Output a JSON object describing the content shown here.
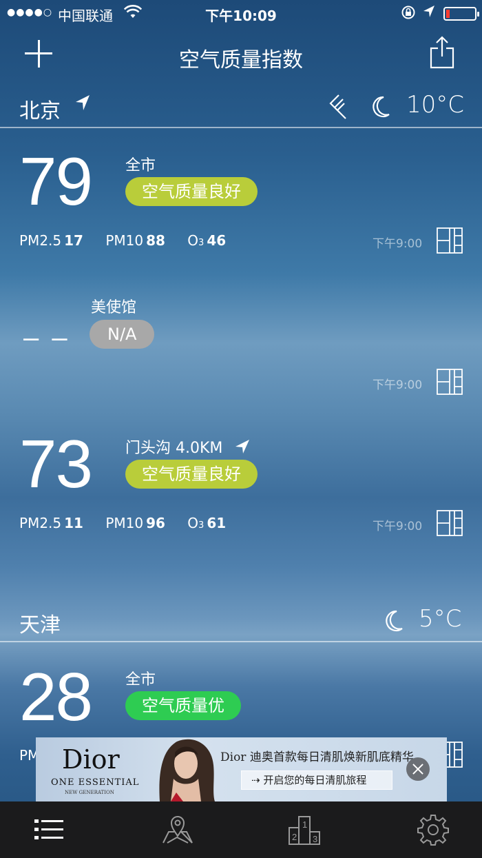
{
  "status_bar": {
    "signal_dots": "●●●●○",
    "carrier": "中国联通",
    "time": "下午10:09",
    "battery_level": 0.12,
    "battery_color": "#ff3b30"
  },
  "nav": {
    "title": "空气质量指数",
    "left_icon": "plus-icon",
    "right_icon": "share-icon"
  },
  "cities": [
    {
      "name": "北京",
      "temperature": "10°C",
      "weather_icon": "moon-icon",
      "extra_icon": "wind-icon",
      "stations": [
        {
          "aqi": "79",
          "name": "全市",
          "status": "空气质量良好",
          "status_color": "#b9cd3a",
          "metrics": [
            {
              "label": "PM2.5",
              "value": "17"
            },
            {
              "label": "PM10",
              "value": "88"
            },
            {
              "label": "O",
              "sub": "3",
              "value": "46"
            }
          ],
          "updated": "下午9:00"
        },
        {
          "aqi": "– –",
          "name": "美使馆",
          "status": "N/A",
          "status_color": "#a8a8a8",
          "updated": "下午9:00"
        },
        {
          "aqi": "73",
          "name": "门头沟 4.0KM",
          "status": "空气质量良好",
          "status_color": "#b9cd3a",
          "metrics": [
            {
              "label": "PM2.5",
              "value": "11"
            },
            {
              "label": "PM10",
              "value": "96"
            },
            {
              "label": "O",
              "sub": "3",
              "value": "61"
            }
          ],
          "updated": "下午9:00"
        }
      ]
    },
    {
      "name": "天津",
      "temperature": "5°C",
      "weather_icon": "moon-icon",
      "stations": [
        {
          "aqi": "28",
          "name": "全市",
          "status": "空气质量优",
          "status_color": "#2ecc52",
          "metrics_peek": "PM"
        }
      ]
    }
  ],
  "ad": {
    "brand": "Dior",
    "line1": "ONE ESSENTIAL",
    "line2": "NEW GENERATION",
    "headline": "Dior 迪奥首款每日清肌焕新肌底精华",
    "cta": "开启您的每日清肌旅程",
    "cta_arrow": "⇢"
  },
  "tab_bar": {
    "items": [
      "list-icon",
      "map-icon",
      "ranking-icon",
      "settings-icon"
    ]
  }
}
